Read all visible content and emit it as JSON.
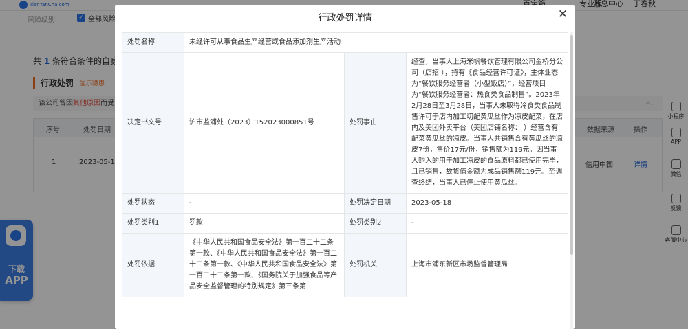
{
  "background": {
    "logo_text": "TianYanCha.com",
    "nav": [
      "百宝箱",
      "专业版",
      "消息中心",
      "丁春秋"
    ],
    "filter": {
      "label": "风险级别",
      "checkbox_label": "全部风险"
    },
    "count_line": {
      "prefix": "共",
      "count": "1",
      "suffix": "条符合条件的自身"
    },
    "section": {
      "title": "行政处罚",
      "link": "显示隐患"
    },
    "notice": {
      "prefix": "该公司曾因",
      "red": "其他原因",
      "suffix": "而受"
    },
    "table": {
      "headers": [
        "序号",
        "处罚日期",
        "数据来源",
        "操作"
      ],
      "row": [
        "1",
        "2023-05-1",
        "信用中国",
        "详情"
      ]
    },
    "sidebar": [
      "小程序",
      "APP",
      "微信",
      "反馈",
      "客服中心"
    ],
    "download": {
      "line1": "下载",
      "line2": "APP"
    }
  },
  "modal": {
    "title": "行政处罚详情",
    "close_icon": "close-icon",
    "rows": {
      "name": {
        "label": "处罚名称",
        "value": "未经许可从事食品生产经营或食品添加剂生产活动"
      },
      "doc": {
        "label": "决定书文号",
        "value": "沪市监浦处（2023）152023000851号"
      },
      "reason": {
        "label": "处罚事由",
        "value": "经查，当事人上海米帆餐饮管理有限公司金桥分公司（店招          ），持有《食品经营许可证》，主体业态为“餐饮服务经营者（小型饭店）”，经营项目为“餐饮服务经营者：热食类食品制售”。2023年2月28日至3月28日，当事人未取得冷食类食品制售许可于店内加工切配黄瓜丝作为凉皮配菜，在店内及美团外卖平台（美团店铺名称：                    ）经营含有配菜黄瓜丝的凉皮。当事人共销售含有黄瓜丝的凉皮7份，售价17元/份，销售额为119元。因当事人购入的用于加工凉皮的食品原料都已使用完毕，且已销售，故货值金额为成品销售额119元。至调查终结，当事人已停止使用黄瓜丝。"
      },
      "status": {
        "label": "处罚状态",
        "value": "-"
      },
      "date": {
        "label": "处罚决定日期",
        "value": "2023-05-18"
      },
      "type1": {
        "label": "处罚类别1",
        "value": "罚款"
      },
      "type2": {
        "label": "处罚类别2",
        "value": "-"
      },
      "basis": {
        "label": "处罚依据",
        "value": "《中华人民共和国食品安全法》第一百二十二条第一款、《中华人民共和国食品安全法》第一百二十二条第一款、《中华人民共和国食品安全法》第一百二十二条第一款、《国务院关于加强食品等产品安全监督管理的特别规定》第三条第"
      },
      "organ": {
        "label": "处罚机关",
        "value": "上海市浦东新区市场监督管理局"
      }
    }
  }
}
